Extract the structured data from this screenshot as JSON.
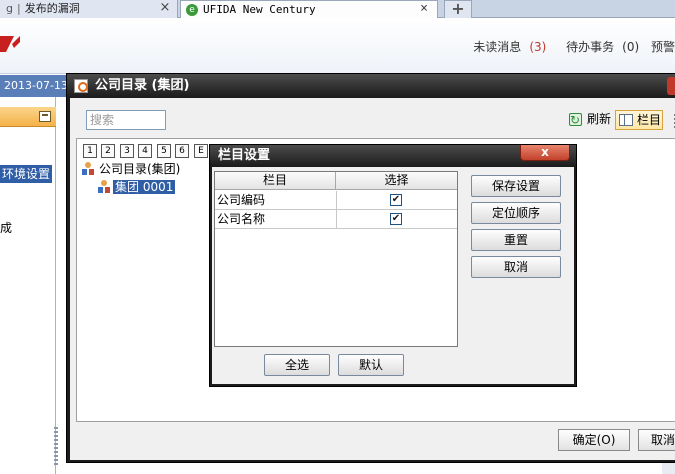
{
  "browser": {
    "tabs": [
      {
        "cut_text": "g",
        "label": "发布的漏洞"
      },
      {
        "label": "UFIDA New Century"
      }
    ],
    "close_glyph": "×",
    "new_tab_glyph": "+"
  },
  "header": {
    "unread_label": "未读消息",
    "unread_count": "(3)",
    "todo_label": "待办事务",
    "todo_count": "(0)",
    "warn_label": "预警"
  },
  "left": {
    "date": "2013-07-13",
    "env_item": "环境设置",
    "item2": "成"
  },
  "outer_dialog": {
    "title": "公司目录 (集团)",
    "search_placeholder": "搜索",
    "refresh_label": "刷新",
    "columns_label": "栏目",
    "level_buttons": [
      "1",
      "2",
      "3",
      "4",
      "5",
      "6",
      "E"
    ],
    "tree_root": "公司目录(集团)",
    "tree_child": "集团 0001",
    "ok_label": "确定(O)",
    "cancel_label": "取消"
  },
  "column_dialog": {
    "title": "栏目设置",
    "close_glyph": "x",
    "headers": {
      "name": "栏目",
      "select": "选择"
    },
    "rows": [
      {
        "name": "公司编码",
        "checked": "✔"
      },
      {
        "name": "公司名称",
        "checked": "✔"
      }
    ],
    "buttons": {
      "save": "保存设置",
      "locate": "定位顺序",
      "reset": "重置",
      "cancel": "取消",
      "select_all": "全选",
      "default": "默认"
    }
  },
  "colors": {
    "title_bar": "#1b1b1b",
    "selection": "#2f5ea7",
    "date_bar": "#5a7eb8",
    "close_red": "#c2412a"
  }
}
